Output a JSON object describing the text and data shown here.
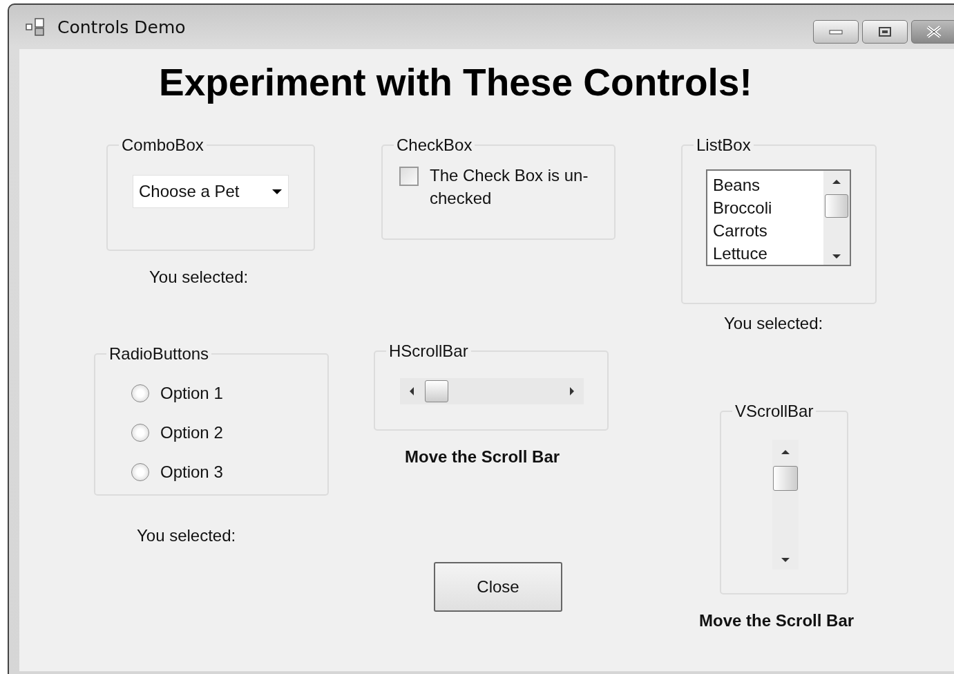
{
  "window": {
    "title": "Controls Demo"
  },
  "heading": "Experiment with These Controls!",
  "combo_group": {
    "label": "ComboBox",
    "combo": {
      "value": "Choose a Pet"
    },
    "result": "You selected:"
  },
  "checkbox_group": {
    "label": "CheckBox",
    "checkbox": {
      "label": "The Check Box is un-checked",
      "checked": false
    }
  },
  "listbox_group": {
    "label": "ListBox",
    "items": [
      {
        "label": "Beans",
        "selected": false
      },
      {
        "label": "Broccoli",
        "selected": false
      },
      {
        "label": "Carrots",
        "selected": false
      },
      {
        "label": "Lettuce",
        "selected": false
      }
    ],
    "result": "You selected:"
  },
  "radio_group": {
    "label": "RadioButtons",
    "options": [
      {
        "label": "Option 1",
        "selected": false
      },
      {
        "label": "Option 2",
        "selected": false
      },
      {
        "label": "Option 3",
        "selected": false
      }
    ],
    "result": "You selected:"
  },
  "hscroll_group": {
    "label": "HScrollBar",
    "caption": "Move the Scroll Bar"
  },
  "vscroll_group": {
    "label": "VScrollBar",
    "caption": "Move the Scroll Bar"
  },
  "buttons": [
    {
      "label": "Close"
    }
  ]
}
